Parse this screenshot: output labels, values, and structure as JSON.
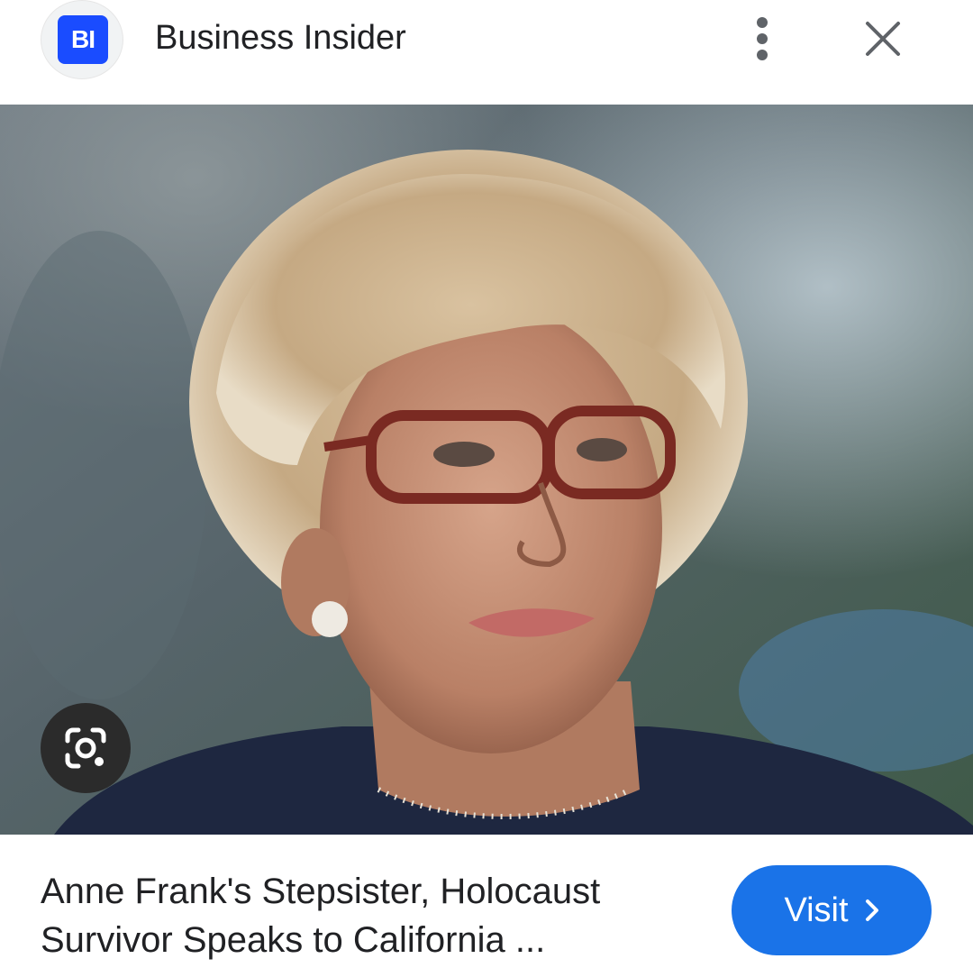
{
  "header": {
    "logo_text": "BI",
    "source_name": "Business Insider",
    "more_icon": "more-vert-icon",
    "close_icon": "close-icon"
  },
  "image": {
    "description_icon": "lens-icon"
  },
  "result": {
    "title_line1": "Anne Frank's Stepsister, Holocaust",
    "title_line2": "Survivor Speaks to California ...",
    "visit_label": "Visit",
    "visit_icon": "chevron-right-icon"
  },
  "colors": {
    "brand": "#1a4cff",
    "accent": "#1a73e8",
    "text": "#202124"
  }
}
